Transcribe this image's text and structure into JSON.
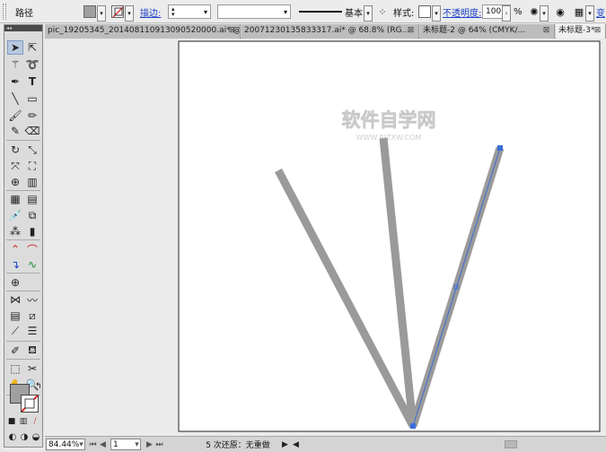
{
  "control_bar": {
    "object_type": "路径",
    "fill_color": "#a0a0a0",
    "stroke_label": "描边:",
    "stroke_weight": "",
    "profile_label": "基本",
    "style_label": "样式:",
    "opacity_label": "不透明度:",
    "opacity_value": "100",
    "opacity_unit": "%",
    "transform_label": "变"
  },
  "tabs": [
    {
      "label": "pic_19205345_201408110913090520000.ai* @ ...",
      "active": false
    },
    {
      "label": "20071230135833317.ai* @ 68.8% (RG...",
      "active": false
    },
    {
      "label": "未标题-2 @ 64% (CMYK/...",
      "active": false
    },
    {
      "label": "未标题-3*",
      "active": true
    }
  ],
  "close_symbol": "⊠",
  "watermark": {
    "title": "软件自学网",
    "subtitle": "WWW.RJZXW.COM"
  },
  "status": {
    "zoom": "84.44%",
    "page": "1",
    "undo_text": "5 次还原：无重做"
  },
  "colors": {
    "stroke_gray": "#9a9a9a",
    "selection_blue": "#3a6ed8",
    "artboard": "#ffffff",
    "canvas_bg": "#ebebeb"
  }
}
